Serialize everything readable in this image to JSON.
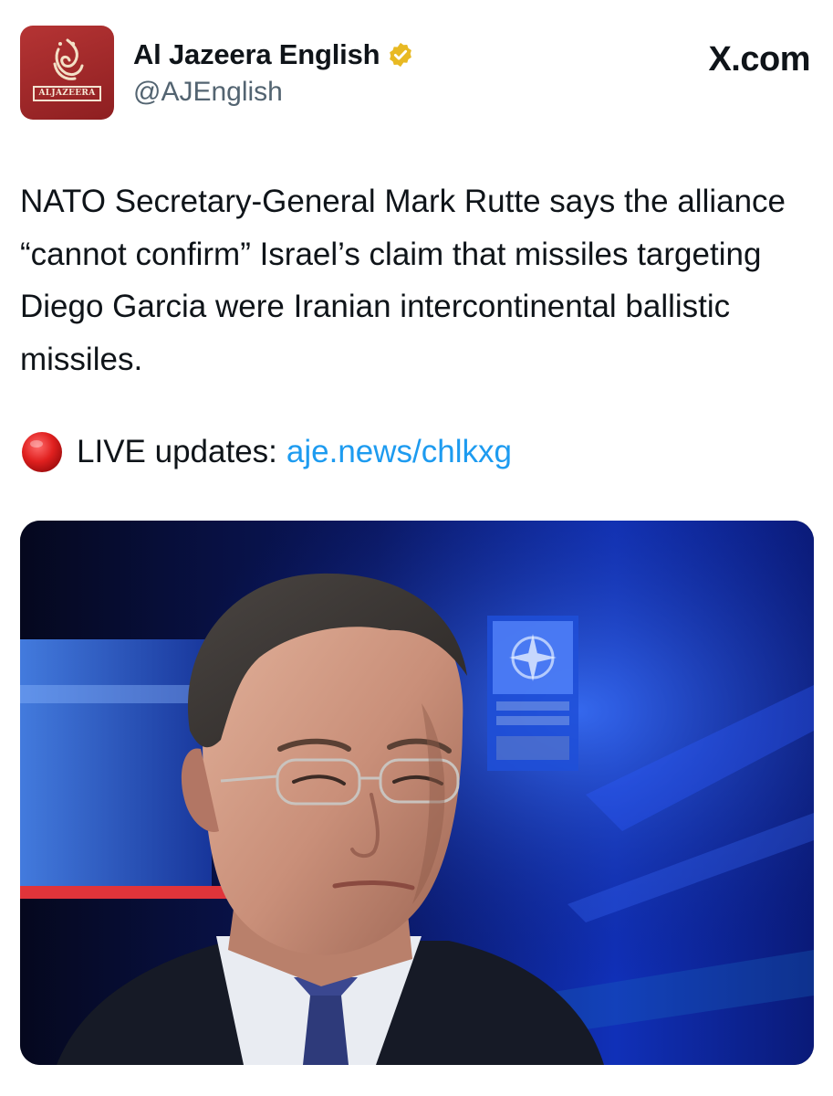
{
  "account": {
    "display_name": "Al Jazeera English",
    "handle": "@AJEnglish",
    "avatar_text": "ALJAZEERA",
    "verified": true,
    "verified_badge_color": "#e8b923"
  },
  "brand": {
    "label": "X.com"
  },
  "tweet": {
    "text": "NATO Secretary-General Mark Rutte says the alliance “cannot confirm” Israel’s claim that missiles targeting Diego Garcia were Iranian intercontinental ballistic missiles.",
    "live_label": "LIVE updates:",
    "live_link": "aje.news/chlkxg",
    "link_color": "#1d9bf0"
  },
  "media": {
    "type": "photo",
    "alt": ""
  },
  "colors": {
    "text": "#0f1419",
    "secondary": "#536471",
    "avatar_bg": "#a52a2a"
  }
}
